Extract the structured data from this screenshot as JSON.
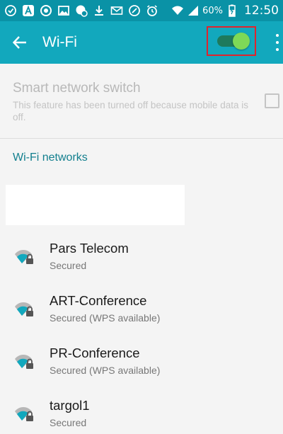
{
  "status_bar": {
    "battery_percent": "60%",
    "time": "12:50",
    "left_icons": [
      "notification-icon",
      "acrobat-icon",
      "sync-icon",
      "image-icon",
      "security-icon",
      "download-icon",
      "mail-icon",
      "data-usage-icon",
      "alarm-icon"
    ],
    "right_icons": [
      "wifi-signal-icon",
      "cellular-signal-icon",
      "battery-charging-icon"
    ]
  },
  "app_bar": {
    "title": "Wi-Fi",
    "wifi_toggle_on": true,
    "colors": {
      "status_bar": "#0a92a6",
      "app_bar": "#12a8bd",
      "toggle_thumb": "#7ed957",
      "highlight_border": "#e0242c"
    }
  },
  "smart_network": {
    "title": "Smart network switch",
    "description": "This feature has been turned off because mobile data is off.",
    "checked": false
  },
  "networks": {
    "header": "Wi-Fi networks",
    "items": [
      {
        "name": "Pars Telecom",
        "status": "Secured"
      },
      {
        "name": "ART-Conference",
        "status": "Secured (WPS available)"
      },
      {
        "name": "PR-Conference",
        "status": "Secured (WPS available)"
      },
      {
        "name": "targol1",
        "status": "Secured"
      }
    ]
  }
}
